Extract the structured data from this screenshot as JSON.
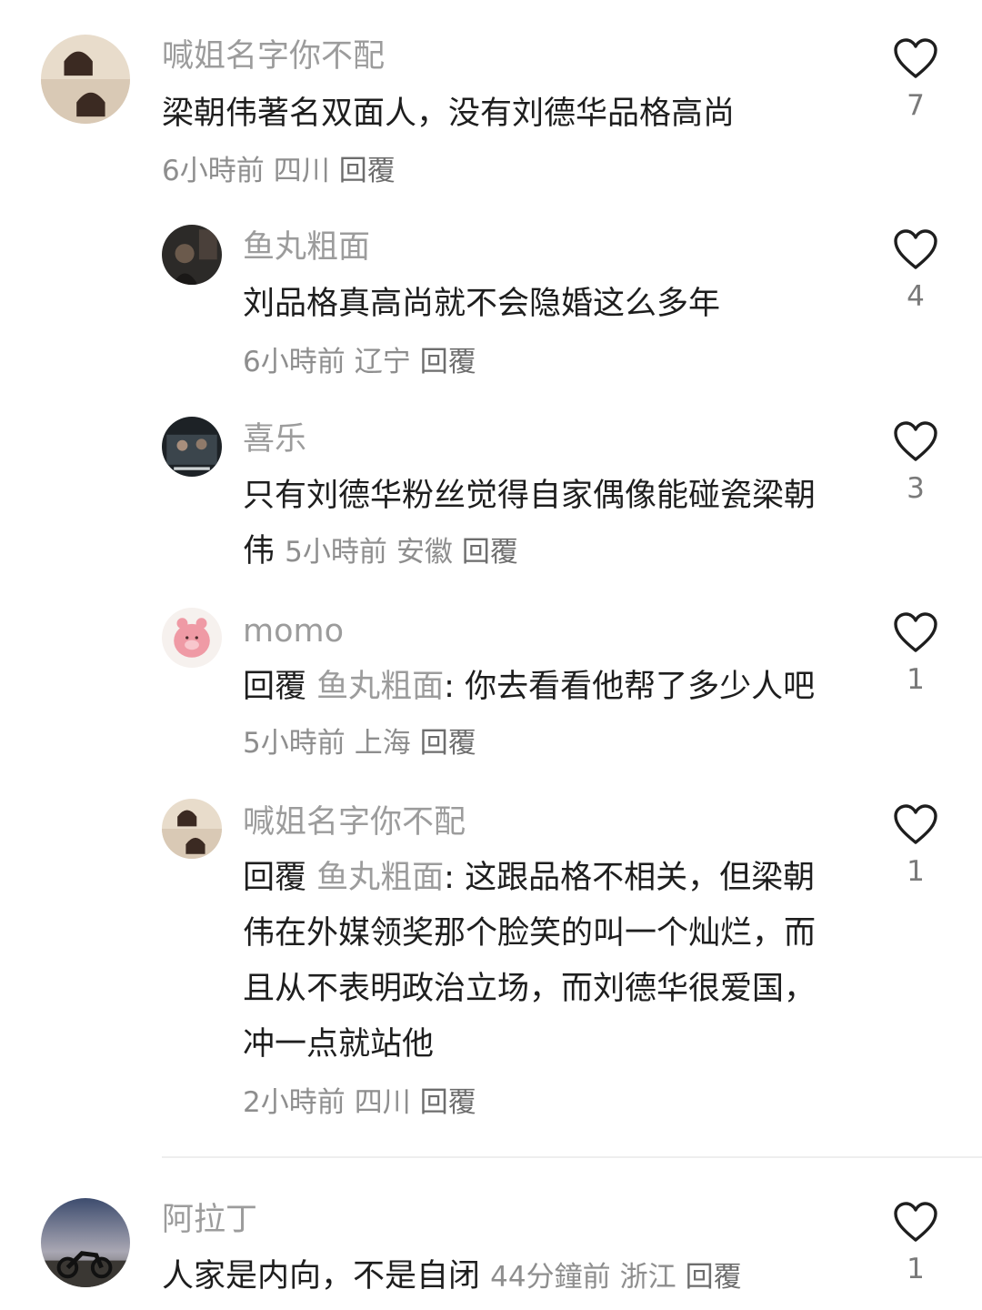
{
  "comments": [
    {
      "name": "喊姐名字你不配",
      "text": "梁朝伟著名双面人，没有刘德华品格高尚",
      "time": "6小時前",
      "location": "四川",
      "reply_label": "回覆",
      "likes": "7"
    },
    {
      "name": "鱼丸粗面",
      "text": "刘品格真高尚就不会隐婚这么多年",
      "time": "6小時前",
      "location": "辽宁",
      "reply_label": "回覆",
      "likes": "4"
    },
    {
      "name": "喜乐",
      "text": "只有刘德华粉丝觉得自家偶像能碰瓷梁朝伟",
      "time": "5小時前",
      "location": "安徽",
      "reply_label": "回覆",
      "likes": "3"
    },
    {
      "name": "momo",
      "reply_prefix": "回覆",
      "reply_to": "鱼丸粗面",
      "text": ": 你去看看他帮了多少人吧",
      "time": "5小時前",
      "location": "上海",
      "reply_label": "回覆",
      "likes": "1"
    },
    {
      "name": "喊姐名字你不配",
      "reply_prefix": "回覆",
      "reply_to": "鱼丸粗面",
      "text": ": 这跟品格不相关，但梁朝伟在外媒领奖那个脸笑的叫一个灿烂，而且从不表明政治立场，而刘德华很爱国，冲一点就站他",
      "time": "2小時前",
      "location": "四川",
      "reply_label": "回覆",
      "likes": "1"
    },
    {
      "name": "阿拉丁",
      "text": "人家是内向，不是自闭",
      "time": "44分鐘前",
      "location": "浙江",
      "reply_label": "回覆",
      "likes": "1"
    }
  ],
  "icons": {
    "like": "heart-outline-icon"
  },
  "colors": {
    "name": "#9c9c9c",
    "text": "#1e1e1e",
    "meta": "#8e8e8e"
  }
}
